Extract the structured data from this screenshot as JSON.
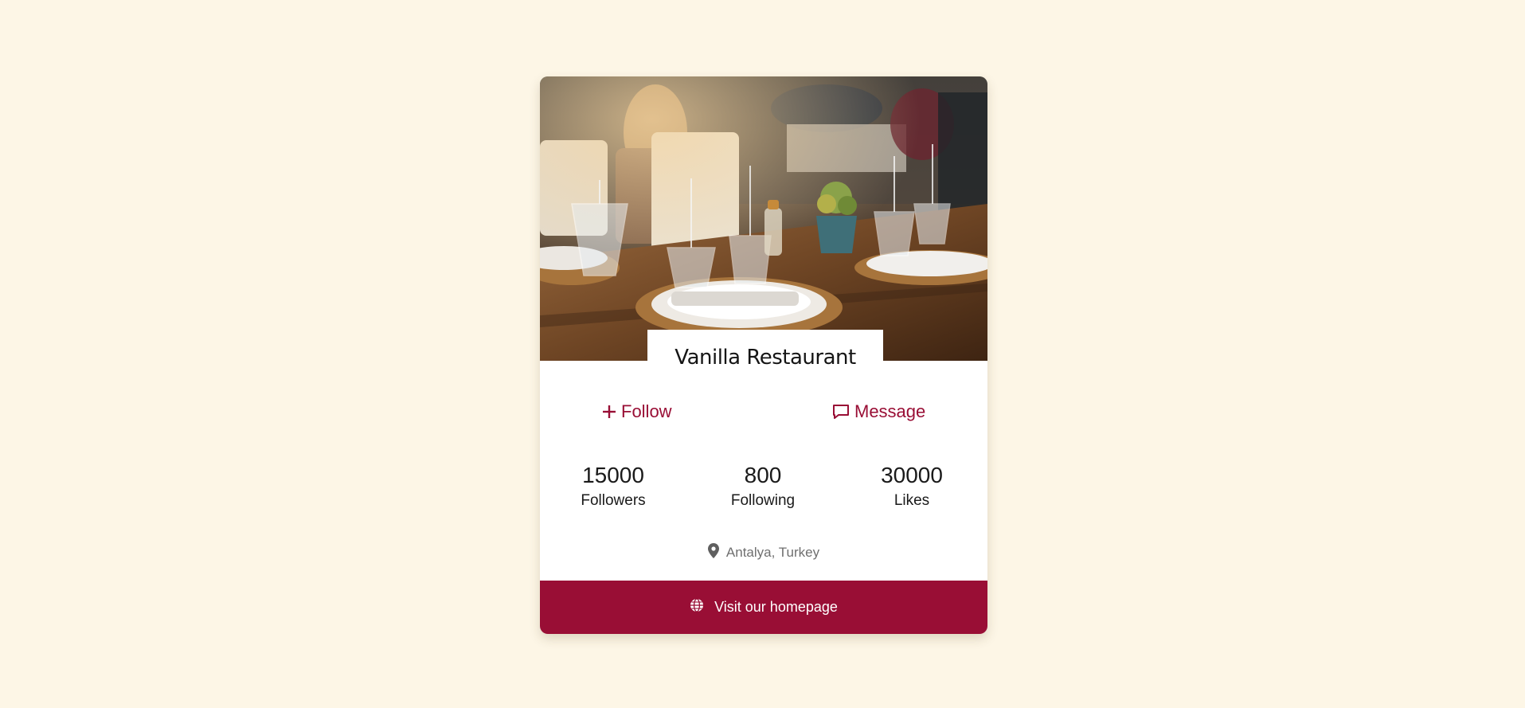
{
  "profile": {
    "name": "Vanilla Restaurant",
    "cover_image": "restaurant-table-setting-photo"
  },
  "actions": {
    "follow_label": "Follow",
    "follow_icon": "plus-icon",
    "message_label": "Message",
    "message_icon": "chat-bubble-icon"
  },
  "stats": [
    {
      "value": "15000",
      "label": "Followers"
    },
    {
      "value": "800",
      "label": "Following"
    },
    {
      "value": "30000",
      "label": "Likes"
    }
  ],
  "location": {
    "text": "Antalya, Turkey",
    "icon": "map-pin-icon"
  },
  "footer": {
    "label": "Visit our homepage",
    "icon": "globe-icon"
  },
  "colors": {
    "page_background": "#fdf6e6",
    "accent": "#990e35",
    "card_background": "#ffffff"
  }
}
